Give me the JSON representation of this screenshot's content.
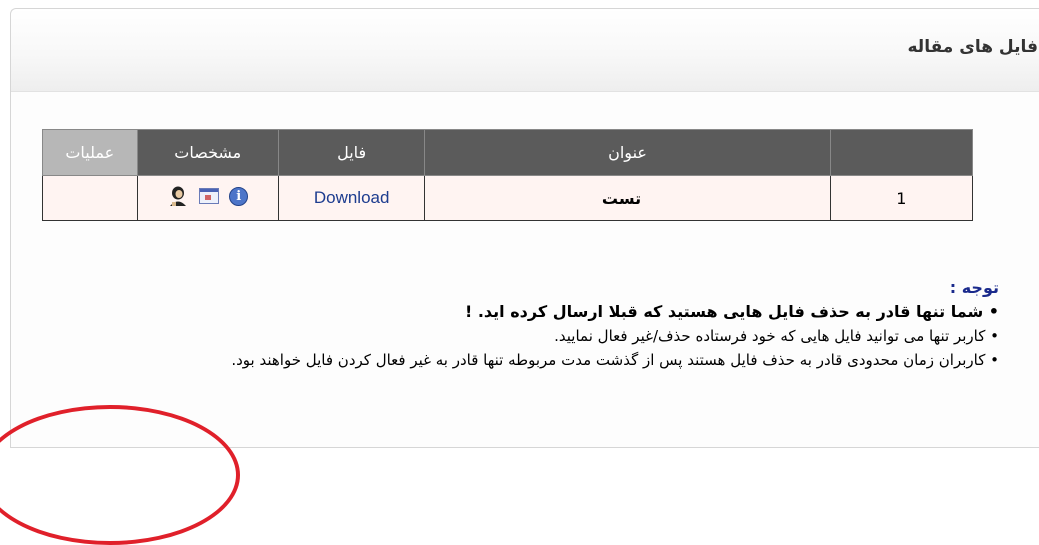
{
  "panel": {
    "title": "فایل های مقاله"
  },
  "table": {
    "headers": {
      "title": "عنوان",
      "file": "فایل",
      "specs": "مشخصات",
      "ops": "عملیات"
    },
    "rows": [
      {
        "num": "1",
        "title": "تست",
        "file": "Download",
        "ops": ""
      }
    ],
    "icons": [
      "info-icon",
      "window-icon",
      "user-icon"
    ]
  },
  "notes": {
    "title": "توجه :",
    "bold": "• شما تنها قادر به حذف فایل هایی هستید که قبلا ارسال کرده اید. !",
    "line1": "• کاربر تنها می توانید فایل هایی که خود فرستاده حذف/غیر فعال نمایید.",
    "line2": "• کاربران زمان محدودی قادر به حذف فایل هستند پس از گذشت مدت مربوطه تنها قادر به غیر فعال کردن فایل خواهند بود."
  },
  "colors": {
    "header_bg": "#5b5b5b",
    "row_bg": "#fff4f2",
    "link": "#1d3c8f",
    "annotation": "#e0202a"
  }
}
